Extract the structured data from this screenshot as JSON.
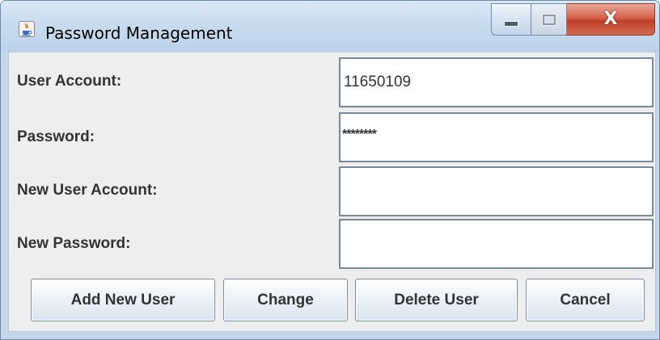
{
  "window": {
    "title": "Password Management"
  },
  "form": {
    "user_account_label": "User Account:",
    "user_account_value": "11650109",
    "password_label": "Password:",
    "password_value": "********",
    "new_user_account_label": "New User Account:",
    "new_user_account_value": "",
    "new_password_label": "New Password:",
    "new_password_value": ""
  },
  "buttons": {
    "add_new_user": "Add New User",
    "change": "Change",
    "delete_user": "Delete User",
    "cancel": "Cancel"
  },
  "controls": {
    "close_glyph": "X"
  },
  "icons": {
    "app": "java-cup-icon",
    "minimize": "minimize-icon",
    "maximize": "maximize-icon",
    "close": "close-icon"
  },
  "colors": {
    "titlebar": "#c9dcef",
    "close_button": "#c13f2a",
    "panel": "#eeeeee",
    "field_bg": "#ffffff"
  }
}
